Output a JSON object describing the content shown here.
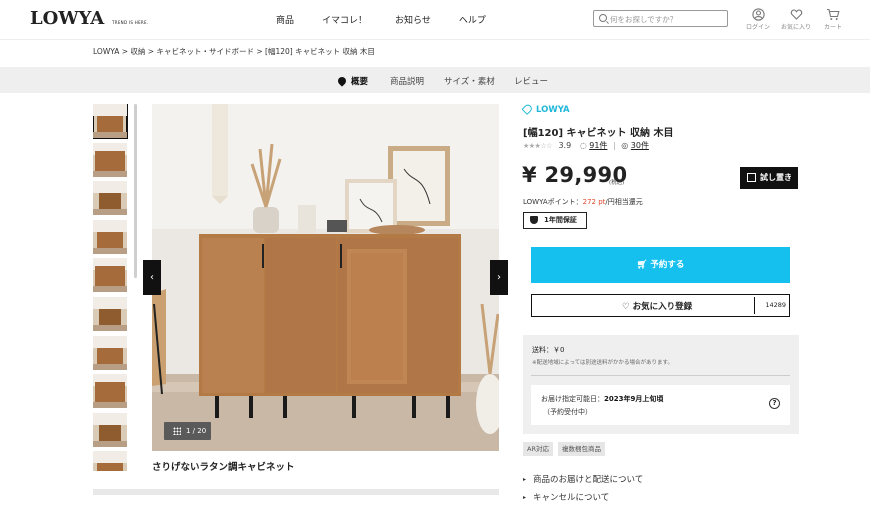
{
  "header": {
    "logo": "LOWYA",
    "logo_sub": "TREND IS HERE.",
    "nav": [
      "商品",
      "イマコレ！",
      "お知らせ",
      "ヘルプ"
    ],
    "search_placeholder": "何をお探しですか？",
    "icons": [
      {
        "icon": "user-icon",
        "label": "ログイン"
      },
      {
        "icon": "heart-icon",
        "label": "お気に入り"
      },
      {
        "icon": "cart-icon",
        "label": "カート"
      }
    ]
  },
  "breadcrumb": "LOWYA > 収納 > キャビネット・サイドボード > [幅120] キャビネット 収納 木目",
  "tabs": {
    "overview": "概要",
    "description": "商品説明",
    "size": "サイズ・素材",
    "review": "レビュー"
  },
  "gallery": {
    "counter": "1 / 20",
    "caption": "さりげないラタン調キャビネット",
    "thumb_count": 10
  },
  "product": {
    "brand": "LOWYA",
    "title": "[幅120] キャビネット 収納 木目",
    "stars": "★★★☆☆",
    "rating": "3.9",
    "reviews": "91件",
    "photos": "30件",
    "price": "¥ 29,990",
    "tax": "(税込)",
    "trial": "試し置き",
    "points_prefix": "LOWYAポイント：",
    "points_value": "272 pt",
    "points_suffix": "/円相当還元",
    "warranty": "1年間保証",
    "reserve_button": "予約する",
    "fav_button": "お気に入り登録",
    "fav_count": "14289"
  },
  "shipping": {
    "fee": "送料：￥0",
    "note": "※配送地域によっては別途送料がかかる場合があります。",
    "delivery_prefix": "お届け指定可能日：",
    "delivery_date": "2023年9月上旬頃",
    "delivery_status": "（予約受付中）",
    "help": "?"
  },
  "chips": [
    "AR対応",
    "複数梱包商品"
  ],
  "links": [
    "商品のお届けと配送について",
    "キャンセルについて"
  ],
  "colors": {
    "accent": "#15c0ef",
    "brand": "#20b7d9",
    "points": "#e0482f"
  }
}
